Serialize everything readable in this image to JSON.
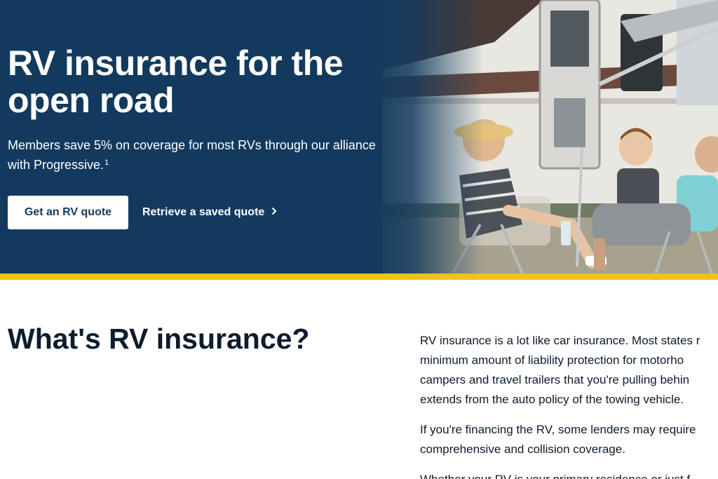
{
  "hero": {
    "title_line1": "RV insurance for the",
    "title_line2": "open road",
    "subtitle": "Members save 5% on coverage for most RVs through our alliance with Progressive.",
    "footnote_marker": "1",
    "primary_button": "Get an RV quote",
    "secondary_link": "Retrieve a saved quote",
    "secondary_link_icon": "chevron-right-icon"
  },
  "section": {
    "title": "What's RV insurance?",
    "paragraph1_lines": [
      "RV insurance is a lot like car insurance. Most states r",
      "minimum amount of liability protection for motorho",
      "campers and travel trailers that you're pulling behin",
      "extends from the auto policy of the towing vehicle."
    ],
    "paragraph2_lines": [
      "If you're financing the RV, some lenders may require",
      "comprehensive and collision coverage."
    ],
    "paragraph3_lines": [
      "Whether your RV is your primary residence or just f"
    ]
  },
  "colors": {
    "hero_background": "#133a5e",
    "accent_band": "#f2c21b",
    "button_background": "#ffffff",
    "button_text": "#133a5e",
    "heading_text": "#0d1c2e"
  }
}
